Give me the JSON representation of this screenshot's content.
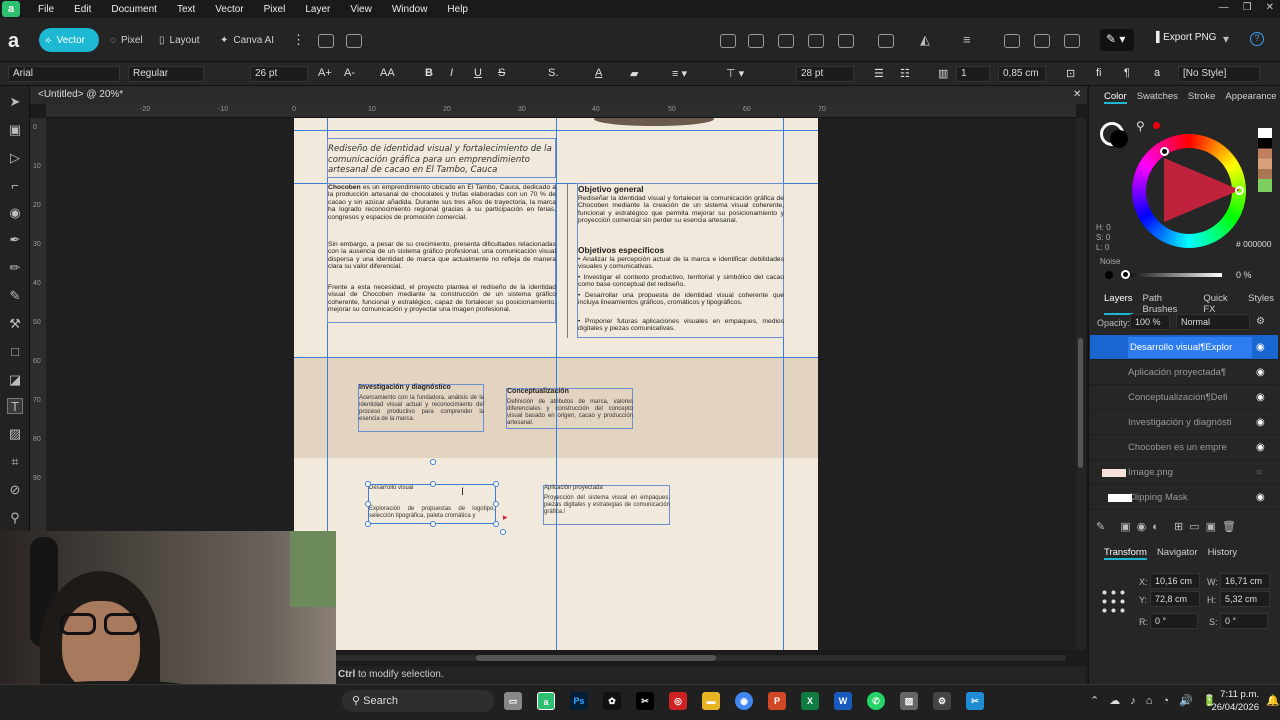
{
  "menu": {
    "items": [
      "File",
      "Edit",
      "Document",
      "Text",
      "Vector",
      "Pixel",
      "Layer",
      "View",
      "Window",
      "Help"
    ]
  },
  "personas": {
    "vector": "Vector",
    "pixel": "Pixel",
    "layout": "Layout",
    "canva_ai": "Canva AI"
  },
  "export": {
    "label": "Export PNG"
  },
  "context": {
    "font": "Arial",
    "style": "Regular",
    "size": "26 pt",
    "leading": "28 pt",
    "columns": "1",
    "gutter": "0,85 cm",
    "paragraph_style": "[No Style]"
  },
  "doc_tab": {
    "title": "<Untitled> @ 20%*"
  },
  "ruler_h": [
    "-20",
    "-10",
    "0",
    "10",
    "20",
    "30",
    "40",
    "50",
    "60",
    "70"
  ],
  "ruler_v": [
    "0",
    "10",
    "20",
    "30",
    "40",
    "50",
    "60",
    "70",
    "80",
    "90"
  ],
  "document": {
    "title": "Rediseño de identidad visual y fortalecimiento de la comunicación gráfica para un emprendimiento artesanal de cacao en El Tambo, Cauca",
    "intro_p1_strong": "Chocoben",
    "intro_p1": " es un emprendimiento ubicado en El Tambo, Cauca, dedicado a la producción artesanal de chocolates y trufas elaboradas con un 70 % de cacao y sin azúcar añadida. Durante sus tres años de trayectoria, la marca ha logrado reconocimiento regional gracias a su participación en ferias, congresos y espacios de promoción comercial.",
    "intro_p2": "Sin embargo, a pesar de su crecimiento, presenta dificultades relacionadas con la ausencia de un sistema gráfico profesional, una comunicación visual dispersa y una identidad de marca que actualmente no refleja de manera clara su valor diferencial.",
    "intro_p3": "Frente a esta necesidad, el proyecto plantea el rediseño de la identidad visual de Chocoben mediante la construcción de un sistema gráfico coherente, funcional y estratégico, capaz de fortalecer su posicionamiento, mejorar su comunicación y proyectar una imagen profesional.",
    "obj_general_title": "Objetivo general",
    "obj_general": "Rediseñar la identidad visual y fortalecer la comunicación gráfica de Chocoben mediante la creación de un sistema visual coherente, funcional y estratégico que permita mejorar su posicionamiento y proyección comercial sin perder su esencia artesanal.",
    "obj_specific_title": "Objetivos específicos",
    "obj_specific": [
      "• Analizar la percepción actual de la marca e identificar debilidades visuales y comunicativas.",
      "• Investigar el contexto productivo, territorial y simbólico del cacao como base conceptual del rediseño.",
      "• Desarrollar una propuesta de identidad visual coherente que incluya lineamientos gráficos, cromáticos y tipográficos.",
      "• Proponer futuras aplicaciones visuales en empaques, medios digitales y piezas comunicativas."
    ],
    "phase1_title": "Investigación y diagnóstico",
    "phase1_text": "Acercamiento con la fundadora, análisis de la identidad visual actual y reconocimiento del proceso productivo para comprender la esencia de la marca.",
    "phase2_title": "Conceptualización",
    "phase2_text": "Definición de atributos de marca, valores diferenciales y construcción del concepto visual basado en origen, cacao y producción artesanal.",
    "phase3_title": "Desarrollo visual",
    "phase3_text": "Exploración de propuestas de logotipo, selección tipográfica, paleta cromática y",
    "phase4_title": "Aplicación proyectada",
    "phase4_text": "Proyección del sistema visual en empaques, piezas digitales y estrategias de comunicación gráfica./"
  },
  "status": {
    "key": "Ctrl",
    "text": " to modify selection."
  },
  "color_panel": {
    "tabs": [
      "Color",
      "Swatches",
      "Stroke",
      "Appearance"
    ],
    "hex": "000000",
    "noise_label": "Noise",
    "noise_value": "0 %",
    "h": "H: 0",
    "s": "S: 0",
    "l": "L: 0"
  },
  "layers_panel": {
    "tabs": [
      "Layers",
      "Path Brushes",
      "Quick FX",
      "Styles"
    ],
    "opacity_label": "Opacity:",
    "opacity": "100 %",
    "blend": "Normal",
    "layers": [
      "Desarrollo visual¶Explor",
      "Aplicación proyectada¶",
      "Conceptualización¶Defi",
      "Investigación y diagnósti",
      "Chocoben es un empre",
      "Image.png",
      "Clipping Mask"
    ]
  },
  "transform_panel": {
    "tabs": [
      "Transform",
      "Navigator",
      "History"
    ],
    "x": "10,16 cm",
    "y": "72,8 cm",
    "w": "16,71 cm",
    "h": "5,32 cm",
    "r": "0 °",
    "s": "0 °",
    "x_label": "X:",
    "y_label": "Y:",
    "w_label": "W:",
    "h_label": "H:",
    "r_label": "R:",
    "s_label": "S:"
  },
  "taskbar": {
    "search": "Search",
    "time": "7:11 p.m.",
    "date": "26/04/2026"
  },
  "colors": {
    "accent": "#1db8d4",
    "selection": "#2d7cf0",
    "guide": "#3c7fd6",
    "page": "#f1e9db"
  }
}
